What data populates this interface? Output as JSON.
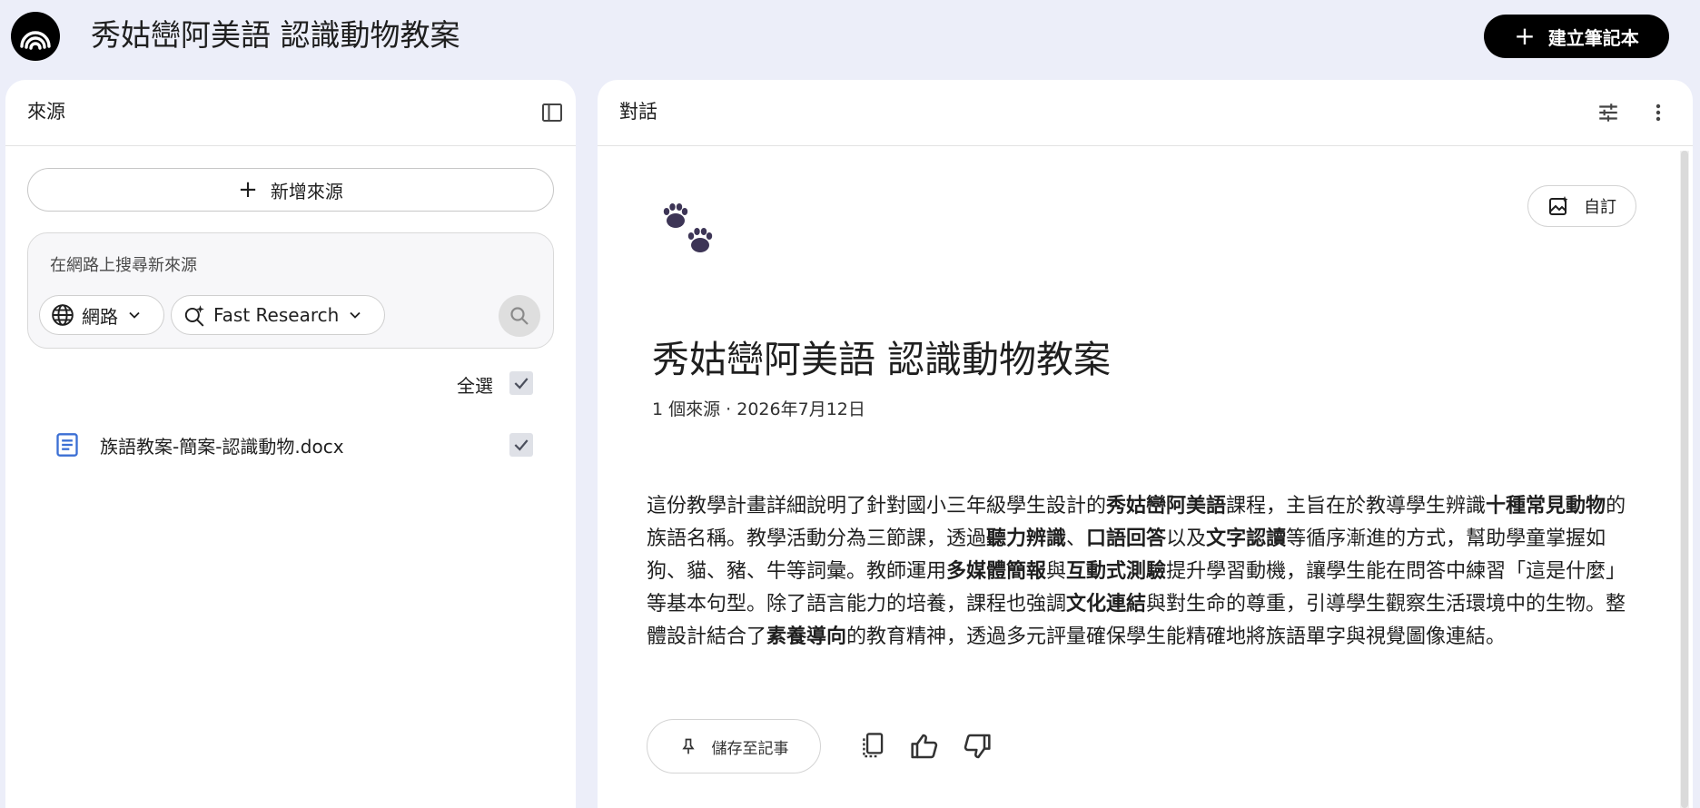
{
  "app": {
    "title": "秀姑巒阿美語 認識動物教案",
    "create_button": "建立筆記本",
    "logo_icon": "notebook-logo-icon"
  },
  "sources_panel": {
    "title": "來源",
    "add_source": "新增來源",
    "search": {
      "placeholder": "在網路上搜尋新來源",
      "scope": "網路",
      "mode": "Fast Research"
    },
    "select_all": "全選",
    "items": [
      {
        "name": "族語教案-簡案-認識動物.docx",
        "checked": true
      }
    ]
  },
  "chat_panel": {
    "title": "對話",
    "customize": "自訂",
    "emoji": "🐾",
    "notebook_title": "秀姑巒阿美語 認識動物教案",
    "meta": "1 個來源 · 2026年7月12日",
    "summary": [
      {
        "t": "這份教學計畫詳細說明了針對國小三年級學生設計的",
        "b": false
      },
      {
        "t": "秀姑巒阿美語",
        "b": true
      },
      {
        "t": "課程，主旨在於教導學生辨識",
        "b": false
      },
      {
        "t": "十種常見動物",
        "b": true
      },
      {
        "t": "的族語名稱。教學活動分為三節課，透過",
        "b": false
      },
      {
        "t": "聽力辨識",
        "b": true
      },
      {
        "t": "、",
        "b": false
      },
      {
        "t": "口語回答",
        "b": true
      },
      {
        "t": "以及",
        "b": false
      },
      {
        "t": "文字認讀",
        "b": true
      },
      {
        "t": "等循序漸進的方式，幫助學童掌握如狗、貓、豬、牛等詞彙。教師運用",
        "b": false
      },
      {
        "t": "多媒體簡報",
        "b": true
      },
      {
        "t": "與",
        "b": false
      },
      {
        "t": "互動式測驗",
        "b": true
      },
      {
        "t": "提升學習動機，讓學生能在問答中練習「這是什麼」等基本句型。除了語言能力的培養，課程也強調",
        "b": false
      },
      {
        "t": "文化連結",
        "b": true
      },
      {
        "t": "與對生命的尊重，引導學生觀察生活環境中的生物。整體設計結合了",
        "b": false
      },
      {
        "t": "素養導向",
        "b": true
      },
      {
        "t": "的教育精神，透過多元評量確保學生能精確地將族語單字與視覺圖像連結。",
        "b": false
      }
    ],
    "save_to_note": "儲存至記事"
  }
}
